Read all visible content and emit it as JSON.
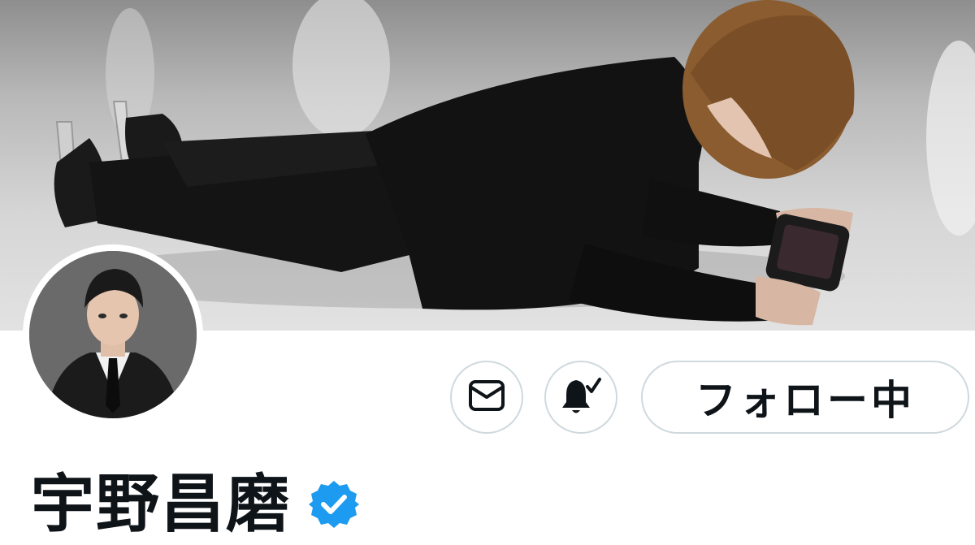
{
  "profile": {
    "display_name": "宇野昌磨",
    "verified": true,
    "banner_image": "photo-skater-lying-on-ice-playing-handheld",
    "avatar_image": "portrait-man-in-black-suit",
    "accent_color": "#1d9bf0"
  },
  "actions": {
    "message_icon": "envelope-icon",
    "notify_icon": "bell-check-icon",
    "follow_label": "フォロー中"
  }
}
